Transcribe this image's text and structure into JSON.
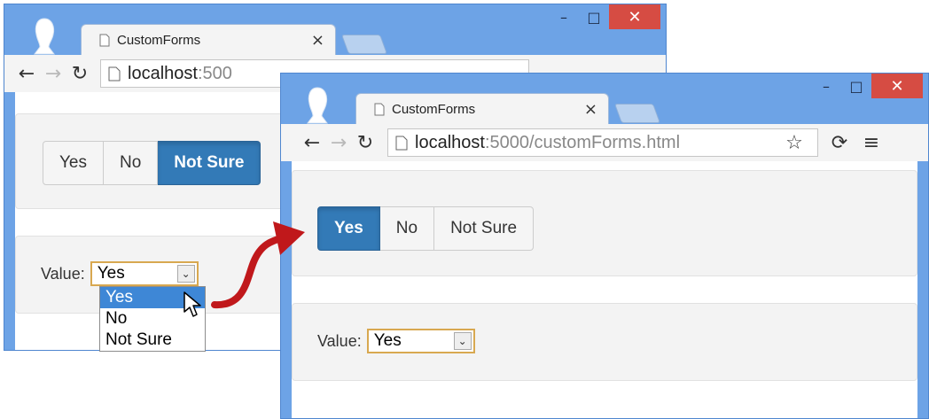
{
  "back_window": {
    "tab": {
      "title": "CustomForms"
    },
    "address": {
      "host": "localhost",
      "path": ":500"
    },
    "buttons": [
      "Yes",
      "No",
      "Not Sure"
    ],
    "active_button": "Not Sure",
    "value_label": "Value:",
    "select_value": "Yes",
    "dropdown_options": [
      "Yes",
      "No",
      "Not Sure"
    ],
    "highlighted_option": "Yes"
  },
  "front_window": {
    "tab": {
      "title": "CustomForms"
    },
    "address": {
      "host": "localhost",
      "path": ":5000/customForms.html"
    },
    "buttons": [
      "Yes",
      "No",
      "Not Sure"
    ],
    "active_button": "Yes",
    "value_label": "Value:",
    "select_value": "Yes"
  },
  "colors": {
    "active_button": "#337ab7",
    "select_border": "#d8a850",
    "close_button": "#d64c43",
    "window_frame": "#6da3e6",
    "arrow": "#c0181b"
  },
  "icons": [
    "minimize-icon",
    "maximize-icon",
    "close-icon",
    "document-icon",
    "back-arrow-icon",
    "forward-arrow-icon",
    "reload-icon",
    "star-icon",
    "sync-icon",
    "menu-icon",
    "chevron-down-icon",
    "mouse-cursor-icon",
    "curved-arrow-icon"
  ]
}
